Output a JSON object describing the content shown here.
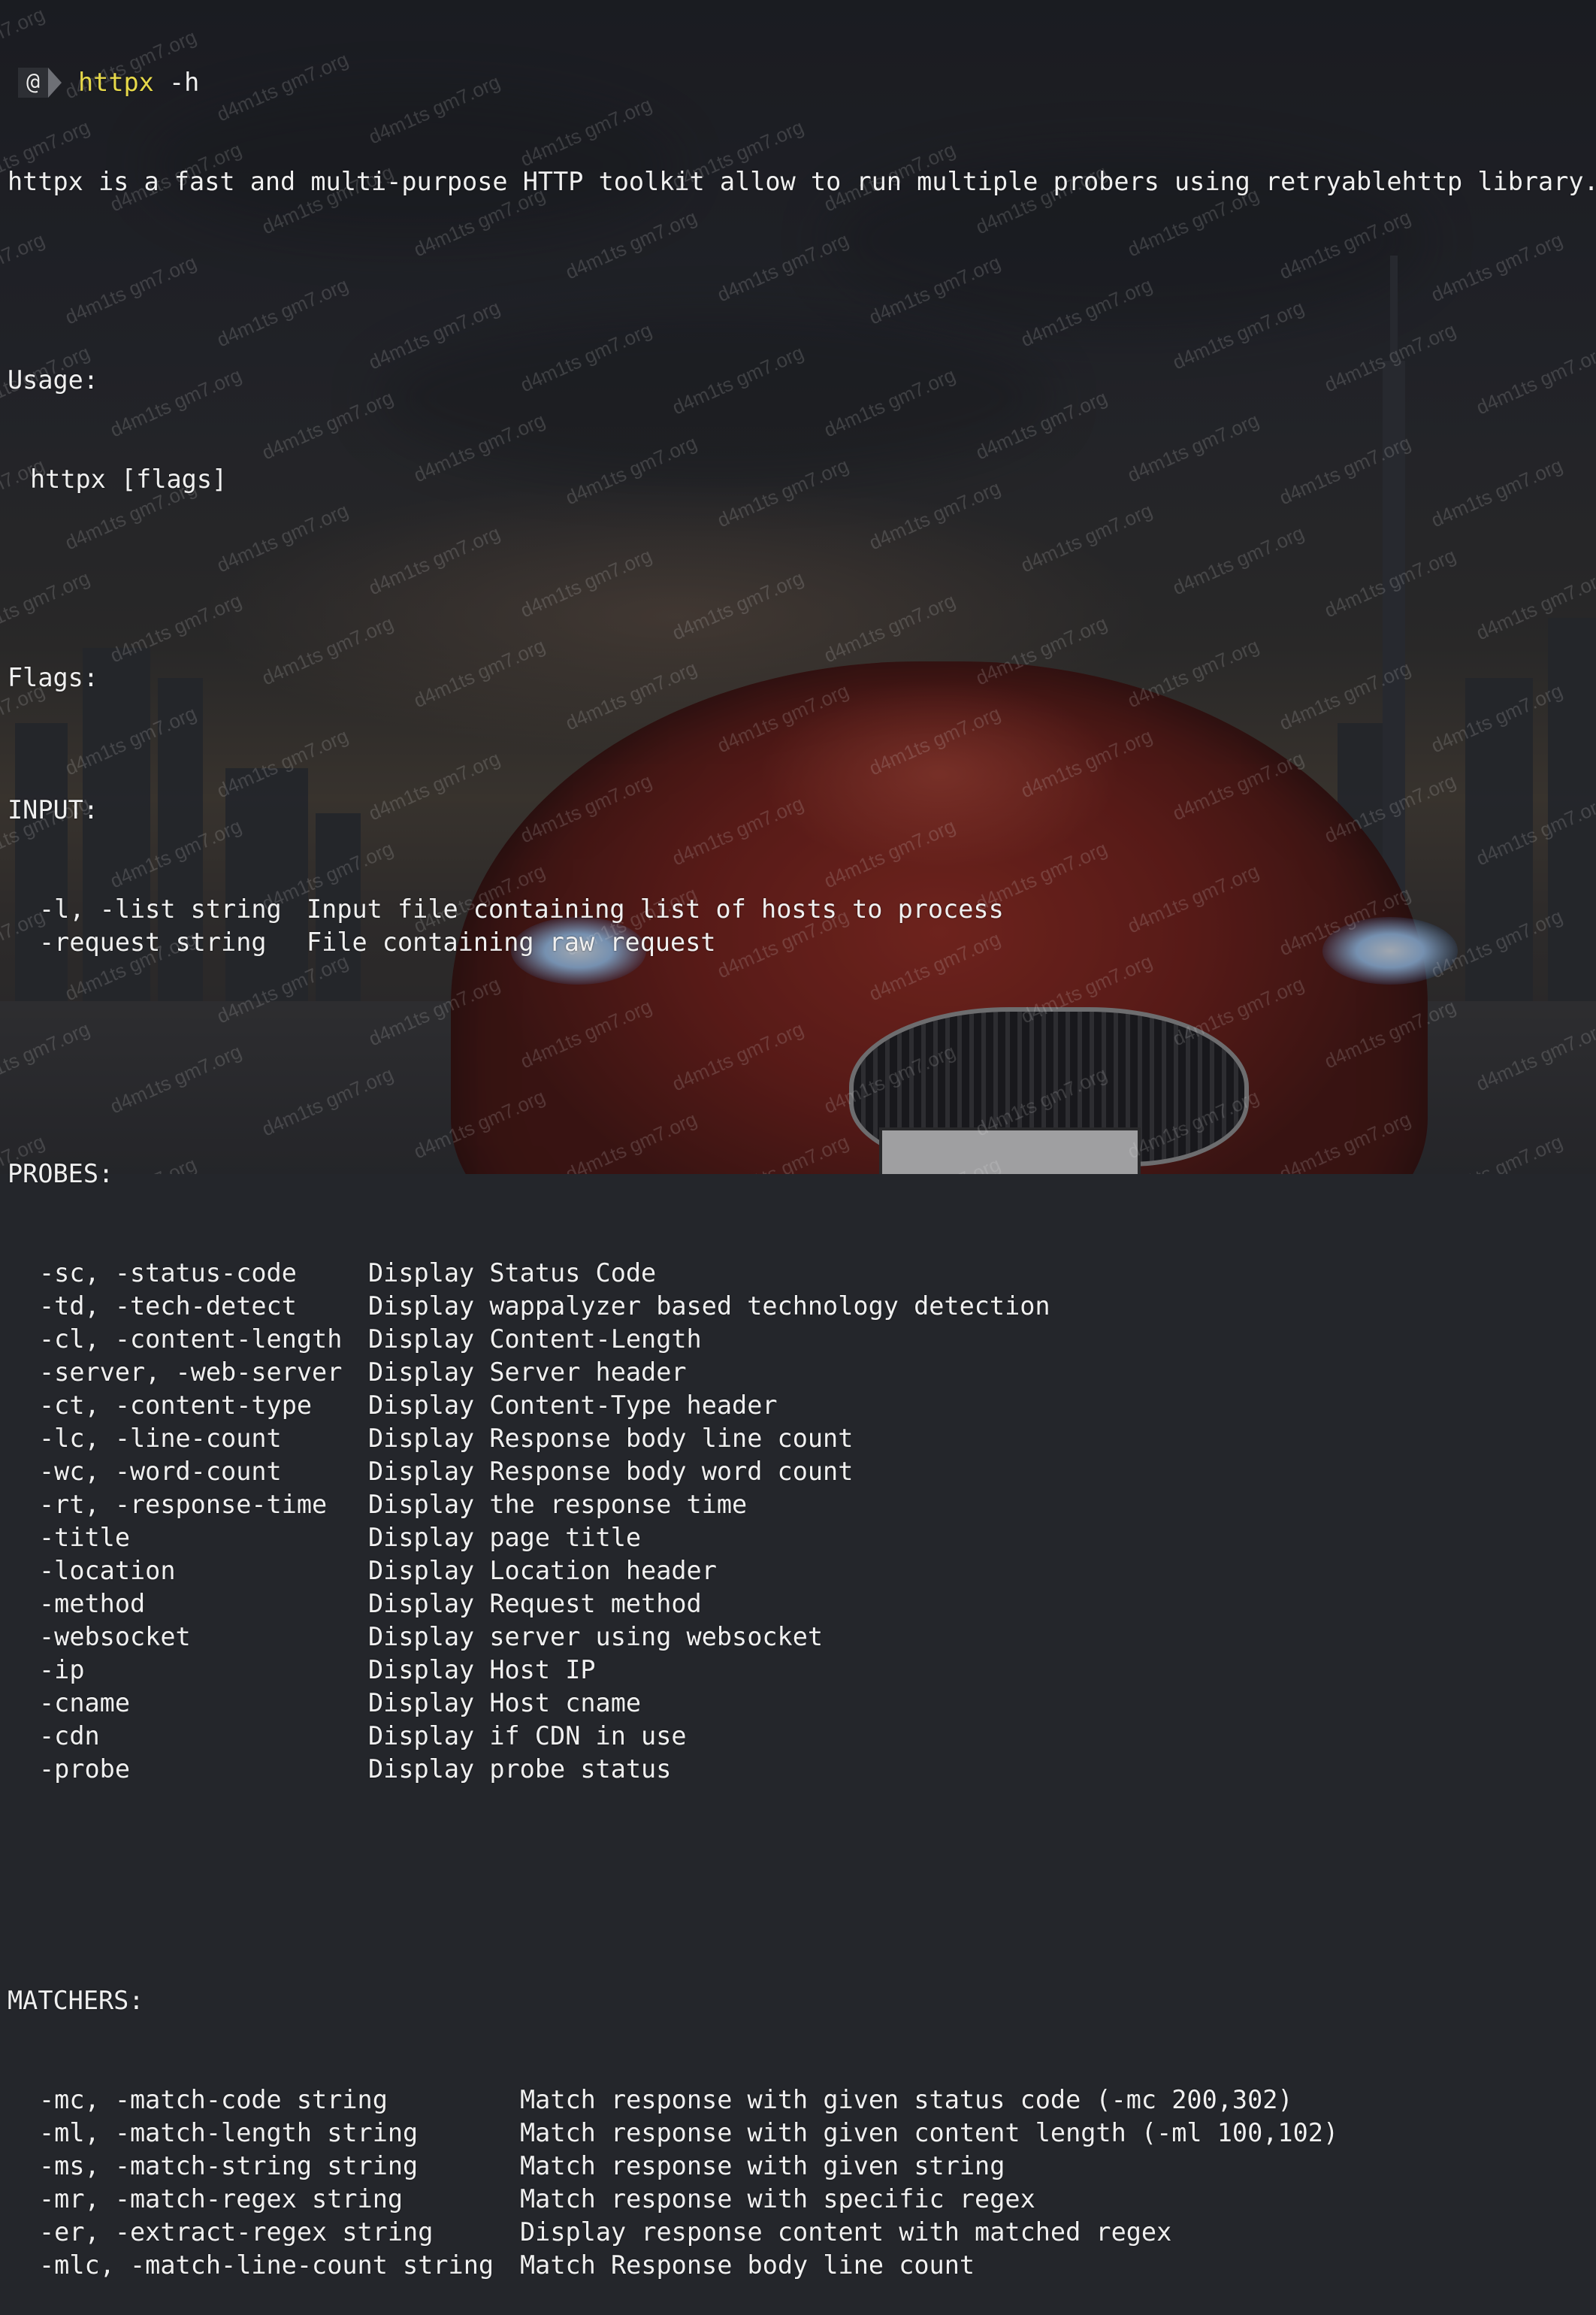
{
  "prompt": {
    "glyph": "@",
    "command": "httpx",
    "args": " -h"
  },
  "description": "httpx is a fast and multi-purpose HTTP toolkit allow to run multiple probers using retryablehttp library.",
  "usage": {
    "heading": "Usage:",
    "line": "httpx [flags]"
  },
  "flags_heading": "Flags:",
  "sections": {
    "input": {
      "heading": "INPUT:",
      "rows": [
        {
          "flag": "-l, -list string",
          "desc": "Input file containing list of hosts to process"
        },
        {
          "flag": "-request string",
          "desc": "File containing raw request"
        }
      ]
    },
    "probes": {
      "heading": "PROBES:",
      "rows": [
        {
          "flag": "-sc, -status-code",
          "desc": "Display Status Code"
        },
        {
          "flag": "-td, -tech-detect",
          "desc": "Display wappalyzer based technology detection"
        },
        {
          "flag": "-cl, -content-length",
          "desc": "Display Content-Length"
        },
        {
          "flag": "-server, -web-server",
          "desc": "Display Server header"
        },
        {
          "flag": "-ct, -content-type",
          "desc": "Display Content-Type header"
        },
        {
          "flag": "-lc, -line-count",
          "desc": "Display Response body line count"
        },
        {
          "flag": "-wc, -word-count",
          "desc": "Display Response body word count"
        },
        {
          "flag": "-rt, -response-time",
          "desc": "Display the response time"
        },
        {
          "flag": "-title",
          "desc": "Display page title"
        },
        {
          "flag": "-location",
          "desc": "Display Location header"
        },
        {
          "flag": "-method",
          "desc": "Display Request method"
        },
        {
          "flag": "-websocket",
          "desc": "Display server using websocket"
        },
        {
          "flag": "-ip",
          "desc": "Display Host IP"
        },
        {
          "flag": "-cname",
          "desc": "Display Host cname"
        },
        {
          "flag": "-cdn",
          "desc": "Display if CDN in use"
        },
        {
          "flag": "-probe",
          "desc": "Display probe status"
        }
      ]
    },
    "matchers": {
      "heading": "MATCHERS:",
      "rows": [
        {
          "flag": "-mc, -match-code string",
          "desc": "Match response with given status code (-mc 200,302)"
        },
        {
          "flag": "-ml, -match-length string",
          "desc": "Match response with given content length (-ml 100,102)"
        },
        {
          "flag": "-ms, -match-string string",
          "desc": "Match response with given string"
        },
        {
          "flag": "-mr, -match-regex string",
          "desc": "Match response with specific regex"
        },
        {
          "flag": "-er, -extract-regex string",
          "desc": "Display response content with matched regex"
        },
        {
          "flag": "-mlc, -match-line-count string",
          "desc": "Match Response body line count"
        }
      ]
    }
  },
  "watermark_text": "d4m1ts gm7.org",
  "colors": {
    "command": "#e6d84a",
    "text": "#f0f0f0",
    "background": "#24262b",
    "car": "#9c2a1e"
  }
}
